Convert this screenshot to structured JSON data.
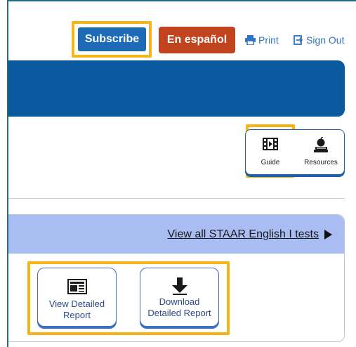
{
  "header": {
    "subscribe_label": "Subscribe",
    "espanol_label": "En español",
    "print_label": "Print",
    "signout_label": "Sign Out"
  },
  "tools": {
    "guide_label": "Guide",
    "resources_label": "Resources"
  },
  "tests": {
    "view_all_label": "View all STAAR English I tests",
    "view_report_line1": "View Detailed",
    "view_report_line2": "Report",
    "download_line1": "Download",
    "download_line2": "Detailed Report"
  },
  "colors": {
    "highlight": "#f5b41a",
    "subscribe_bg": "#1d6bb8",
    "espanol_bg": "#c2441e",
    "banner": "#0b5aa0",
    "card_header": "#a9bdf2",
    "link": "#2f73c4"
  },
  "icons": [
    "printer-icon",
    "sign-out-icon",
    "film-guide-icon",
    "apple-books-icon",
    "newspaper-icon",
    "download-arrow-icon"
  ]
}
